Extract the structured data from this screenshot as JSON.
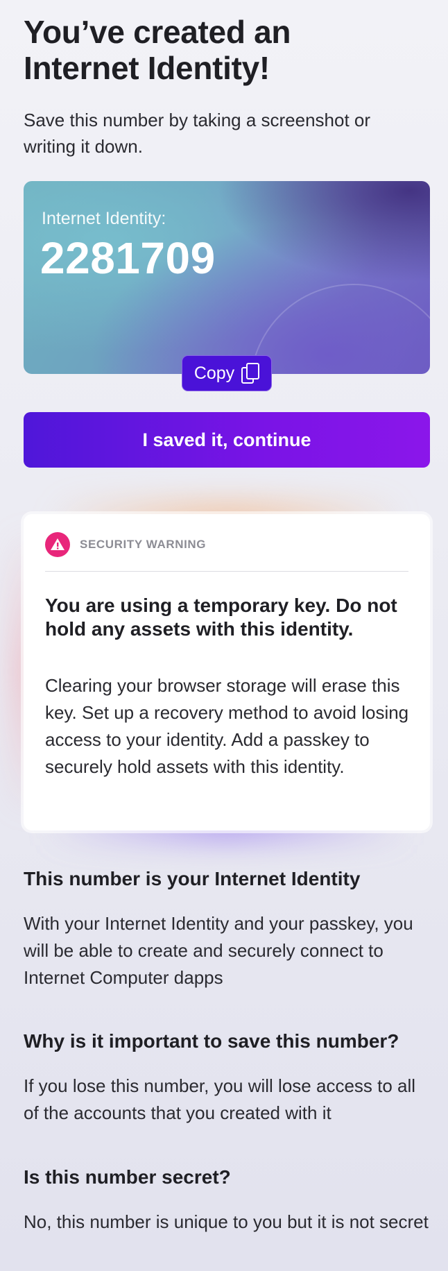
{
  "header": {
    "title": "You’ve created an Internet Identity!",
    "subtitle": "Save this number by taking a screenshot or writing it down."
  },
  "identity_card": {
    "label": "Internet Identity:",
    "number": "2281709"
  },
  "actions": {
    "copy_label": "Copy",
    "continue_label": "I saved it, continue"
  },
  "security_warning": {
    "label": "SECURITY WARNING",
    "title": "You are using a temporary key. Do not hold any assets with this identity.",
    "body": "Clearing your browser storage will erase this key. Set up a recovery method to avoid losing access to your identity. Add a passkey to securely hold assets with this identity.",
    "icon": "alert-triangle-icon",
    "icon_color": "#e8267a"
  },
  "faq": [
    {
      "question": "This number is your Internet Identity",
      "answer": "With your Internet Identity and your passkey, you will be able to create and securely connect to Internet Computer dapps"
    },
    {
      "question": "Why is it important to save this number?",
      "answer": "If you lose this number, you will lose access to all of the accounts that you created with it"
    },
    {
      "question": "Is this number secret?",
      "answer": "No, this number is unique to you but it is not secret"
    }
  ],
  "colors": {
    "primary": "#4a12d8",
    "primary_gradient_end": "#8b16ea",
    "text": "#1f1f24"
  }
}
